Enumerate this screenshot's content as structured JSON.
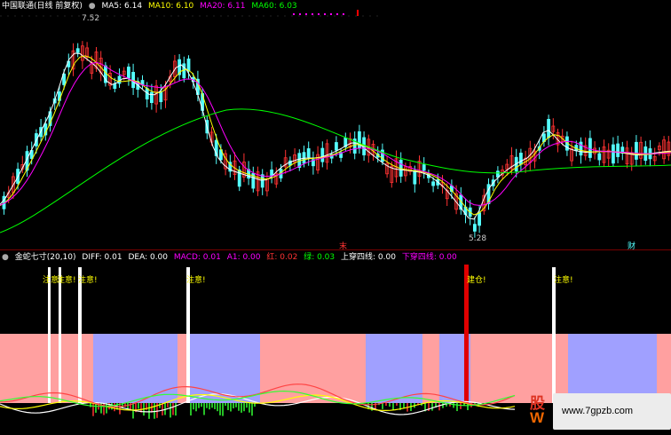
{
  "price_header": {
    "title": "中国联通(日线 前复权)",
    "ma5": "MA5: 6.14",
    "ma10": "MA10: 6.10",
    "ma20": "MA20: 6.11",
    "ma60": "MA60: 6.03",
    "high_label": "7.52",
    "low_label": "5.28",
    "marker_left": "末",
    "marker_right": "财"
  },
  "indicator_header": {
    "name": "金蛇七寸(20,10)",
    "diff": "DIFF: 0.01",
    "dea": "DEA: 0.00",
    "macd": "MACD: 0.01",
    "a1": "A1: 0.00",
    "red": "红: 0.02",
    "green": "绿: 0.03",
    "up_cross": "上穿四线: 0.00",
    "down_cross": "下穿四线: 0.00"
  },
  "signals": {
    "notice": "注意!",
    "build": "建仓!"
  },
  "watermark": {
    "logo_top": "股",
    "logo_bottom": "W",
    "url": "www.7gpzb.com"
  },
  "colors": {
    "ma5": "#ffffff",
    "ma10": "#ffff00",
    "ma20": "#ff00ff",
    "ma60": "#00ff00",
    "up": "#ff3232",
    "down": "#54ffff",
    "band_pink": "#ffa0a0",
    "band_blue": "#a0a0ff",
    "build_bar": "#e00000"
  }
}
